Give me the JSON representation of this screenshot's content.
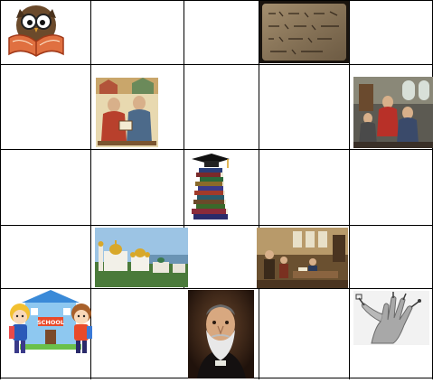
{
  "grid": {
    "rows": 5,
    "columns": 5,
    "line_color": "#000000",
    "background": "#ffffff"
  },
  "tiles": [
    {
      "id": "owl-reading-book",
      "row": 1,
      "col": 1,
      "icon": "owl-with-book-icon"
    },
    {
      "id": "ancient-clay-tablet",
      "row": 1,
      "col": 4,
      "icon": "cuneiform-tablet-icon"
    },
    {
      "id": "medieval-scribes-miniature",
      "row": 2,
      "col": 2,
      "icon": "scribes-miniature-icon"
    },
    {
      "id": "monastery-school-painting",
      "row": 2,
      "col": 5,
      "icon": "monks-study-icon"
    },
    {
      "id": "stack-of-books-graduation-cap",
      "row": 3,
      "col": 3,
      "icon": "books-stack-cap-icon"
    },
    {
      "id": "lavra-monastery-domes",
      "row": 4,
      "col": 2,
      "icon": "golden-domes-icon"
    },
    {
      "id": "old-classroom-painting",
      "row": 4,
      "col": 4,
      "icon": "classroom-scene-icon"
    },
    {
      "id": "children-at-school-building",
      "row": 5,
      "col": 1,
      "icon": "school-kids-icon",
      "sign": "SCHOOL"
    },
    {
      "id": "bearded-scholar-portrait",
      "row": 5,
      "col": 3,
      "icon": "scholar-portrait-icon"
    },
    {
      "id": "hand-with-writing-tools",
      "row": 5,
      "col": 5,
      "icon": "hand-pens-icon"
    }
  ]
}
